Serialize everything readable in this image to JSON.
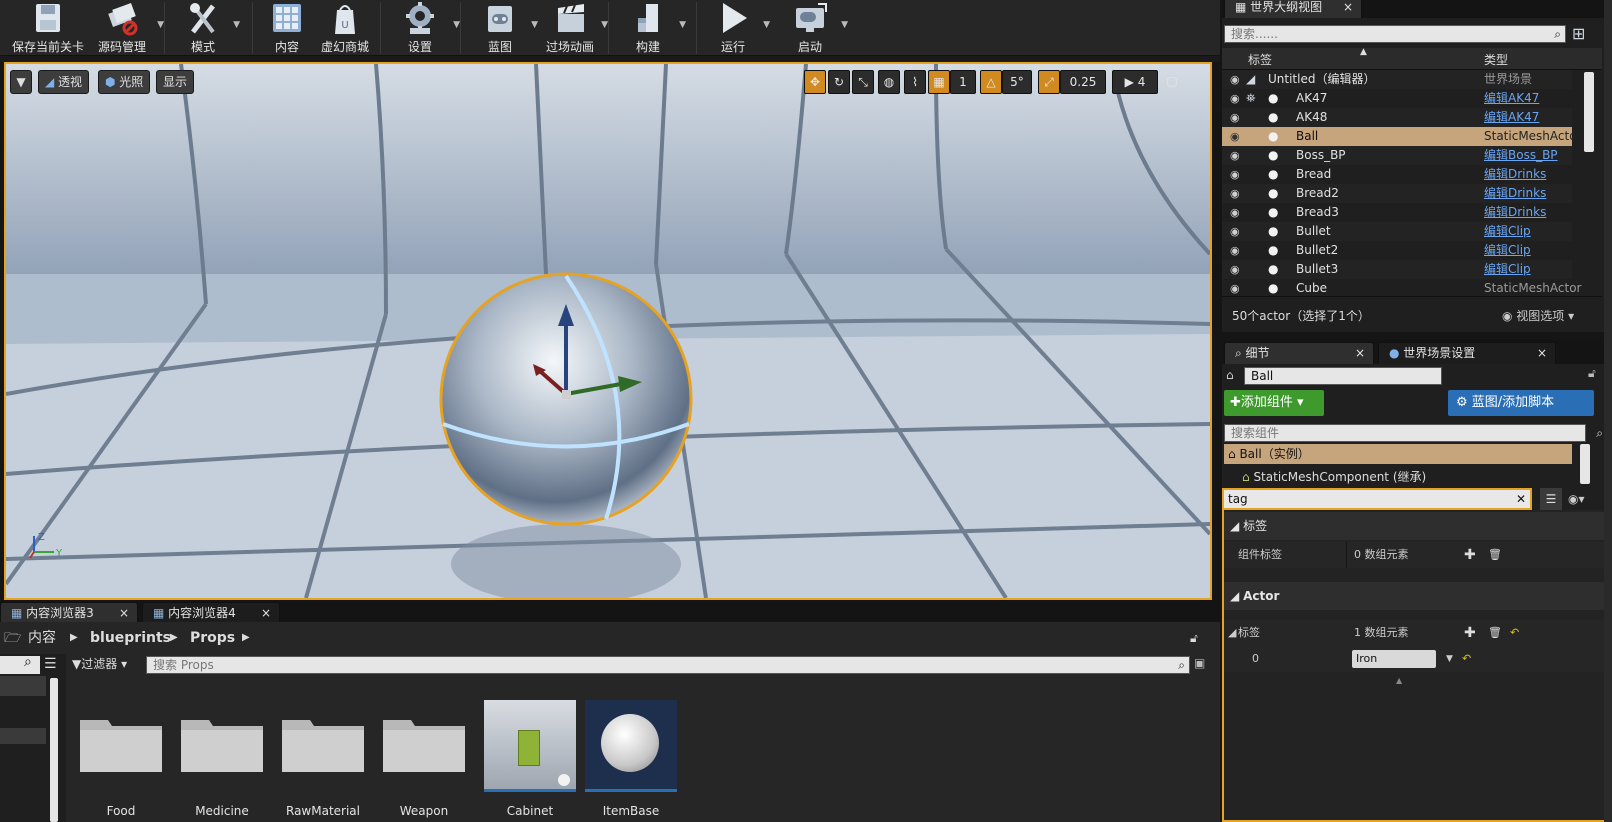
{
  "toolbar": {
    "items": [
      {
        "label": "保存当前关卡",
        "icon": "save-icon"
      },
      {
        "label": "源码管理",
        "icon": "source-control-icon"
      },
      {
        "label": "模式",
        "icon": "modes-icon"
      },
      {
        "label": "内容",
        "icon": "content-icon"
      },
      {
        "label": "虚幻商城",
        "icon": "marketplace-icon"
      },
      {
        "label": "设置",
        "icon": "settings-gear-icon"
      },
      {
        "label": "蓝图",
        "icon": "blueprint-icon"
      },
      {
        "label": "过场动画",
        "icon": "cinematics-icon"
      },
      {
        "label": "构建",
        "icon": "build-icon"
      },
      {
        "label": "运行",
        "icon": "play-icon"
      },
      {
        "label": "启动",
        "icon": "launch-icon"
      }
    ]
  },
  "viewport": {
    "perspective": "透视",
    "lit": "光照",
    "show": "显示",
    "grid_snap": "1",
    "rot_snap": "5°",
    "scale_snap": "0.25",
    "cam_speed": "4",
    "axis_z": "Z",
    "axis_y": "Y"
  },
  "outliner": {
    "tab": "世界大纲视图",
    "search_placeholder": "搜索......",
    "col_label": "标签",
    "col_type": "类型",
    "rows": [
      {
        "name": "Untitled（编辑器）",
        "type": "世界场景",
        "link": false
      },
      {
        "name": "AK47",
        "type": "编辑AK47",
        "link": true
      },
      {
        "name": "AK48",
        "type": "编辑AK47",
        "link": true
      },
      {
        "name": "Ball",
        "type": "StaticMeshActor",
        "link": false
      },
      {
        "name": "Boss_BP",
        "type": "编辑Boss_BP",
        "link": true
      },
      {
        "name": "Bread",
        "type": "编辑Drinks",
        "link": true
      },
      {
        "name": "Bread2",
        "type": "编辑Drinks",
        "link": true
      },
      {
        "name": "Bread3",
        "type": "编辑Drinks",
        "link": true
      },
      {
        "name": "Bullet",
        "type": "编辑Clip",
        "link": true
      },
      {
        "name": "Bullet2",
        "type": "编辑Clip",
        "link": true
      },
      {
        "name": "Bullet3",
        "type": "编辑Clip",
        "link": true
      },
      {
        "name": "Cube",
        "type": "StaticMeshActor",
        "link": false
      }
    ],
    "status": "50个actor（选择了1个）",
    "view_options": "视图选项"
  },
  "details": {
    "tab_details": "细节",
    "tab_world": "世界场景设置",
    "actor_name": "Ball",
    "add_component": "添加组件",
    "blueprint_button": "蓝图/添加脚本",
    "search_components_placeholder": "搜索组件",
    "component_root": "Ball（实例）",
    "component_child": "StaticMeshComponent (继承)",
    "filter_text": "tag",
    "section_tags": "标签",
    "component_tags_label": "组件标签",
    "component_tags_value": "0 数组元素",
    "section_actor": "Actor",
    "tags_label": "标签",
    "tags_value": "1 数组元素",
    "tag_index": "0",
    "tag_value": "Iron"
  },
  "content_browser": {
    "tabs": [
      "内容浏览器3",
      "内容浏览器4"
    ],
    "path": [
      "内容",
      "blueprints",
      "Props"
    ],
    "filters": "过滤器",
    "search_placeholder": "搜索 Props",
    "assets": [
      "Food",
      "Medicine",
      "RawMaterial",
      "Weapon",
      "Cabinet",
      "ItemBase"
    ]
  },
  "colors": {
    "accent": "#e5a223",
    "link": "#6aa5f2",
    "selected_row": "#c7a57c",
    "add_green": "#3e9a2c",
    "blueprint_blue": "#2a6fb5"
  }
}
